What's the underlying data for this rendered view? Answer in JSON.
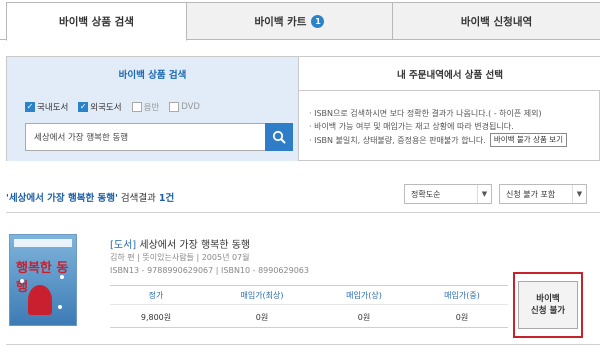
{
  "top_tabs": [
    {
      "label": "바이백 상품 검색"
    },
    {
      "label": "바이백 카트",
      "badge": "1"
    },
    {
      "label": "바이백 신청내역"
    }
  ],
  "sub_tabs": [
    {
      "label": "바이백 상품 검색"
    },
    {
      "label": "내 주문내역에서 상품 선택"
    }
  ],
  "filters": [
    {
      "label": "국내도서",
      "checked": true
    },
    {
      "label": "외국도서",
      "checked": true
    },
    {
      "label": "음반",
      "checked": false
    },
    {
      "label": "DVD",
      "checked": false
    }
  ],
  "search": {
    "value": "세상에서 가장 행복한 동행"
  },
  "notices": [
    "· ISBN으로 검색하시면 보다 정확한 결과가 나옵니다.( - 하이픈 제외)",
    "· 바이백 가능 여부 및 매입가는 재고 상황에 따라 변경됩니다.",
    "· ISBN 불일치, 상태불량, 증정용은 판매불가 합니다."
  ],
  "standard_button": "바이백 불가 상품 보기",
  "results": {
    "query": "'세상에서 가장 행복한 동행'",
    "label": "검색결과",
    "count": "1건"
  },
  "sorts": [
    {
      "label": "정확도순"
    },
    {
      "label": "신청 불가 포함"
    }
  ],
  "book": {
    "type": "[도서]",
    "title": "세상에서 가장 행복한 동행",
    "meta": "김하 편 | 뜻이있는사람들 | 2005년 07월",
    "isbn": "ISBN13 - 9788990629067 | ISBN10 - 8990629063",
    "cover_text": "행복한 동행",
    "price_headers": [
      "정가",
      "매입가(최상)",
      "매입가(상)",
      "매입가(중)"
    ],
    "price_values": [
      "9,800원",
      "0원",
      "0원",
      "0원"
    ],
    "action_line1": "바이백",
    "action_line2": "신청 불가"
  },
  "colors": {
    "accent": "#2a82c7",
    "highlight": "#c4242b",
    "panel_bg": "#e1ecf8"
  }
}
